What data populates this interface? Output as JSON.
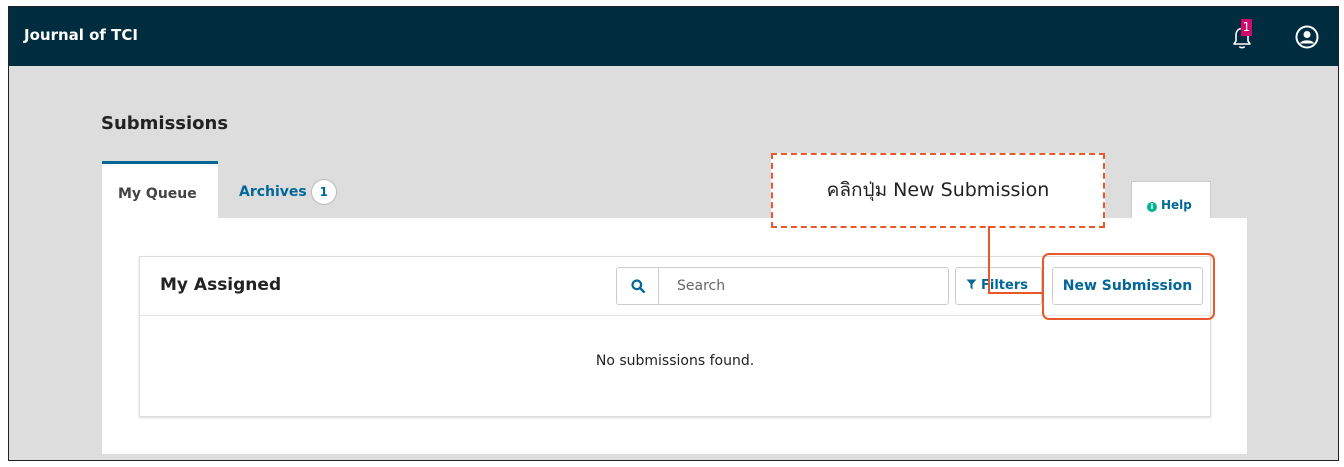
{
  "header": {
    "site_name": "Journal of TCI",
    "notification_count": "1"
  },
  "page": {
    "title": "Submissions"
  },
  "tabs": {
    "my_queue": "My Queue",
    "archives": "Archives",
    "archives_count": "1",
    "help": "Help"
  },
  "list": {
    "title": "My Assigned",
    "search_placeholder": "Search",
    "filters_label": "Filters",
    "new_submission_label": "New Submission",
    "empty_message": "No submissions found."
  },
  "annotation": {
    "callout_text": "คลิกปุ่ม New Submission",
    "color": "#e8582a"
  },
  "colors": {
    "header_bg": "#002c40",
    "link": "#006798",
    "badge": "#d00a6c",
    "help_icon": "#00b28d"
  },
  "icons": [
    "bell-icon",
    "user-profile-icon",
    "search-icon",
    "filter-icon",
    "info-icon"
  ]
}
